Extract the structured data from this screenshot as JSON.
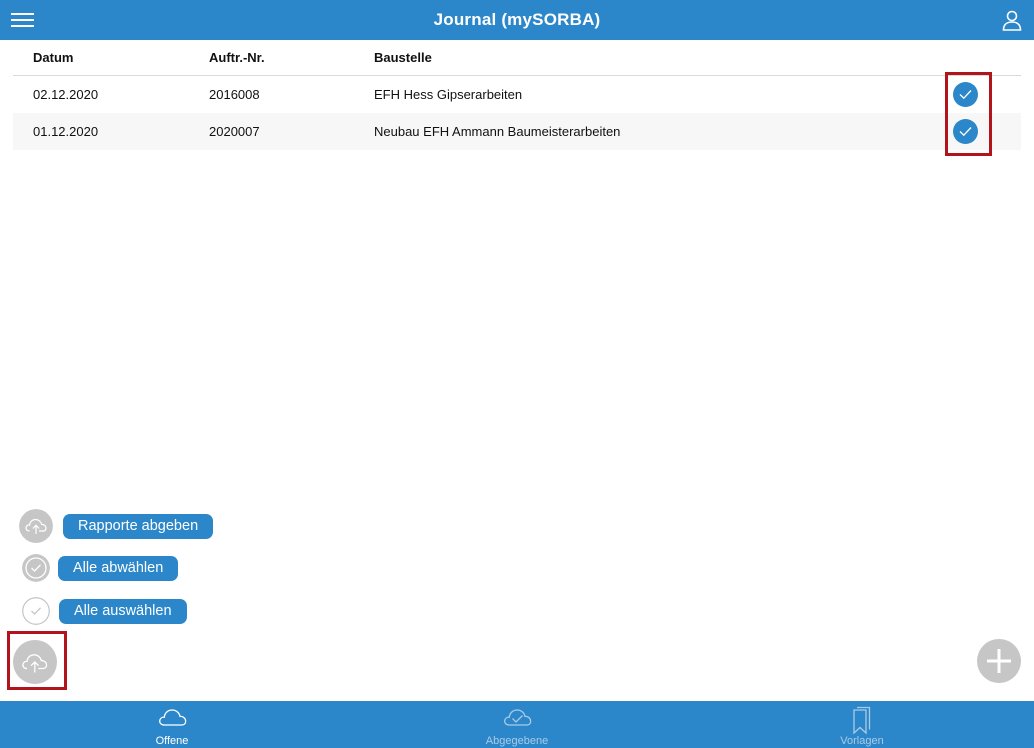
{
  "header": {
    "title": "Journal (mySORBA)",
    "menu_icon": "hamburger-menu-icon",
    "user_icon": "user-profile-icon"
  },
  "table": {
    "columns": [
      "Datum",
      "Auftr.-Nr.",
      "Baustelle"
    ],
    "rows": [
      {
        "datum": "02.12.2020",
        "auftr": "2016008",
        "baustelle": "EFH Hess Gipserarbeiten",
        "selected": true
      },
      {
        "datum": "01.12.2020",
        "auftr": "2020007",
        "baustelle": "Neubau EFH Ammann Baumeisterarbeiten",
        "selected": true
      }
    ]
  },
  "actions": {
    "submit_reports": "Rapporte abgeben",
    "deselect_all": "Alle abwählen",
    "select_all": "Alle auswählen"
  },
  "tabs": [
    {
      "label": "Offene",
      "icon": "cloud-icon",
      "active": true
    },
    {
      "label": "Abgegebene",
      "icon": "cloud-check-icon",
      "active": false
    },
    {
      "label": "Vorlagen",
      "icon": "bookmarks-icon",
      "active": false
    }
  ],
  "colors": {
    "primary": "#2b87c9",
    "highlight": "#b1151b",
    "fab_gray": "#c6c6c6"
  }
}
